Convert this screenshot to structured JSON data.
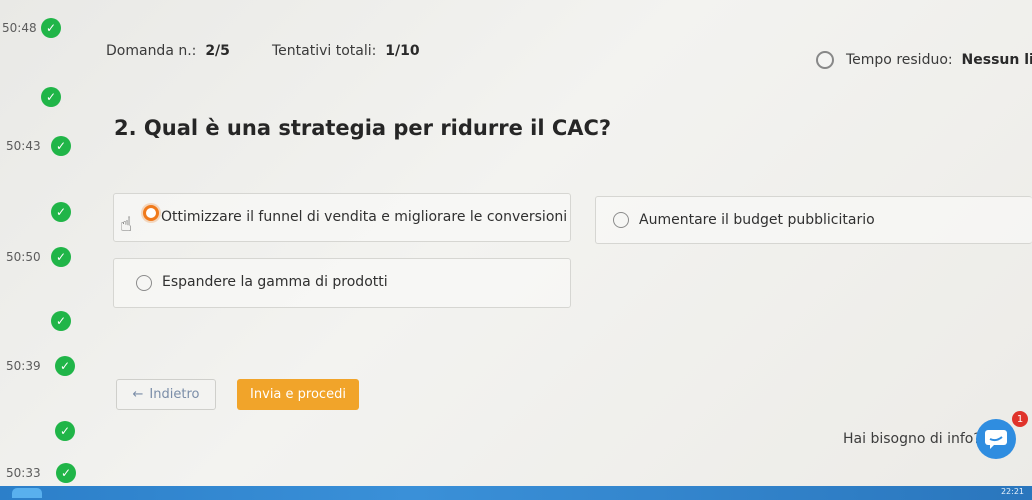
{
  "timeline": {
    "times": [
      "50:48",
      "50:43",
      "50:50",
      "50:39",
      "50:33"
    ]
  },
  "header": {
    "question_number_label": "Domanda n.:",
    "question_number_value": "2/5",
    "attempts_label": "Tentativi totali:",
    "attempts_value": "1/10",
    "time_left_label": "Tempo residuo:",
    "time_left_value": "Nessun lim"
  },
  "question": {
    "text": "2. Qual è una strategia per ridurre il CAC?"
  },
  "options": [
    {
      "label": "Ottimizzare il funnel di vendita e migliorare le conversioni",
      "selected": true
    },
    {
      "label": "Aumentare il budget pubblicitario",
      "selected": false
    },
    {
      "label": "Espandere la gamma di prodotti",
      "selected": false
    }
  ],
  "buttons": {
    "back_arrow": "←",
    "back_label": "Indietro",
    "next_label": "Invia e procedi"
  },
  "help": {
    "text": "Hai bisogno di info?",
    "badge_count": "1"
  },
  "taskbar": {
    "clock": "22:21"
  },
  "colors": {
    "accent": "#f1a42a",
    "selected_radio": "#f07a1c",
    "check_green": "#20b548",
    "chat_blue": "#2f8de0"
  }
}
